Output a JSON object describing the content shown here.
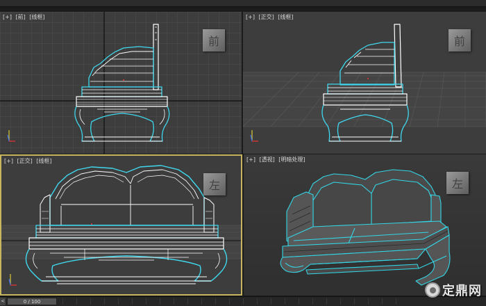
{
  "menu": {
    "items": [
      "",
      "",
      ""
    ]
  },
  "viewports": {
    "top_left": {
      "labels": [
        "[+]",
        "[前]",
        "[线框]"
      ],
      "cube": "前"
    },
    "top_right": {
      "labels": [
        "[+]",
        "[正交]",
        "[线框]"
      ],
      "cube": "前"
    },
    "bottom_left": {
      "labels": [
        "[+]",
        "[正交]",
        "[线框]"
      ],
      "cube": "左"
    },
    "bottom_right": {
      "labels": [
        "[+]",
        "[透视]",
        "[明暗处理]"
      ],
      "cube": "左"
    },
    "active": "bottom_left"
  },
  "timeline": {
    "frame": "0 / 100"
  },
  "watermark": {
    "text": "定鼎网"
  },
  "colors": {
    "viewport_bg": "#3d3d3d",
    "wireframe": "#ffffff",
    "outline": "#33d6e6",
    "active_border": "#c8b560",
    "grid": "#555555",
    "grid_axis": "#1a1a1a"
  }
}
